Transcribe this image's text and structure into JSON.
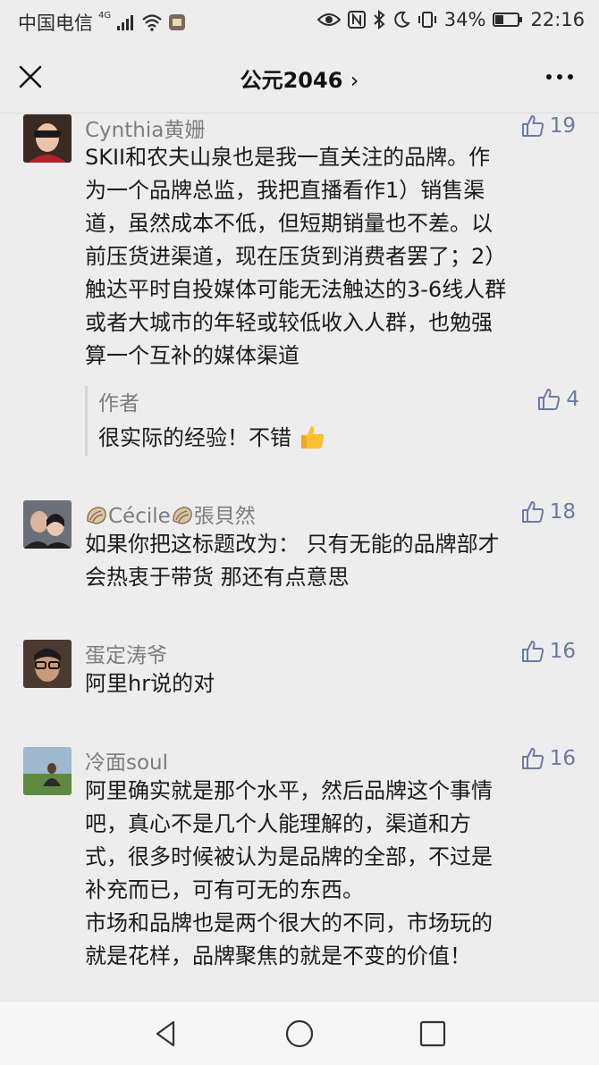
{
  "status_bar": {
    "carrier": "中国电信",
    "network": "4G",
    "battery": "34%",
    "time": "22:16"
  },
  "nav": {
    "title": "公元2046",
    "chevron": "›"
  },
  "comments": [
    {
      "name": "Cynthia黄姗",
      "likes": "19",
      "text": "SKII和农夫山泉也是我一直关注的品牌。作\n为一个品牌总监，我把直播看作1）销售渠\n道，虽然成本不低，但短期销量也不差。以\n前压货进渠道，现在压货到消费者罢了；2）\n触达平时自投媒体可能无法触达的3-6线人群\n或者大城市的年轻或较低收入人群，也勉强\n算一个互补的媒体渠道",
      "reply": {
        "name": "作者",
        "likes": "4",
        "text": "很实际的经验！不错"
      }
    },
    {
      "name": "Cécile",
      "name_suffix": "張貝然",
      "likes": "18",
      "text": "如果你把这标题改为： 只有无能的品牌部才\n会热衷于带货 那还有点意思"
    },
    {
      "name": "蛋定涛爷",
      "likes": "16",
      "text": "阿里hr说的对"
    },
    {
      "name": "冷面soul",
      "likes": "16",
      "text": "阿里确实就是那个水平，然后品牌这个事情\n吧，真心不是几个人能理解的，渠道和方\n式，很多时候被认为是品牌的全部，不过是\n补充而已，可有可无的东西。\n市场和品牌也是两个很大的不同，市场玩的\n就是花样，品牌聚焦的就是不变的价值！"
    }
  ],
  "colors": {
    "background": "#ededed",
    "like_color": "#6b7aa0",
    "name_color": "#7d7d7d"
  }
}
